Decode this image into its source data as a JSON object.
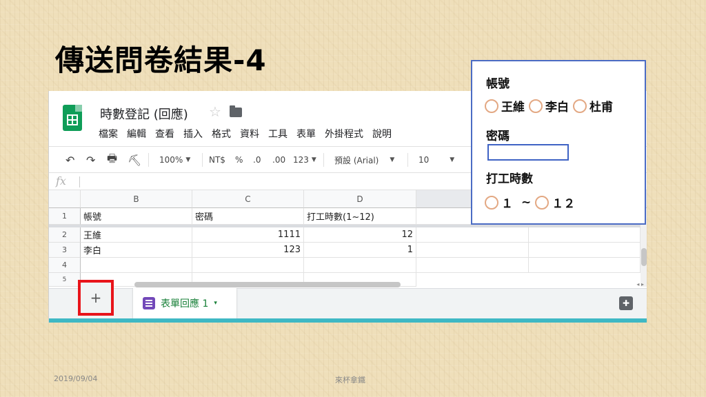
{
  "slide": {
    "title": "傳送問卷結果-4",
    "footer_date": "2019/09/04",
    "footer_center": "來杯拿鐵"
  },
  "app": {
    "doc_title": "時數登記 (回應)",
    "star_icon": "☆",
    "menu": [
      "檔案",
      "編輯",
      "查看",
      "插入",
      "格式",
      "資料",
      "工具",
      "表單",
      "外掛程式",
      "說明"
    ]
  },
  "toolbar": {
    "zoom": "100%",
    "currency": "NT$",
    "percent": "%",
    "dec_decrease": ".0",
    "dec_increase": ".00",
    "more_formats": "123",
    "font": "預設 (Arial)",
    "font_size": "10",
    "undo_icon": "↶",
    "redo_icon": "↷",
    "print_icon": "🖶",
    "paint_icon": "⛏"
  },
  "formula_bar": {
    "fx": "fx"
  },
  "sheet": {
    "columns": [
      "B",
      "C",
      "D",
      ""
    ],
    "rows": [
      {
        "num": "1",
        "cells": [
          "帳號",
          "密碼",
          "打工時數(1~12)",
          "",
          ""
        ]
      },
      {
        "num": "2",
        "cells": [
          "王維",
          "1111",
          "12",
          "",
          ""
        ]
      },
      {
        "num": "3",
        "cells": [
          "李白",
          "123",
          "1",
          "",
          ""
        ]
      },
      {
        "num": "4",
        "cells": [
          "",
          "",
          "",
          "",
          ""
        ]
      },
      {
        "num": "5",
        "cells": [
          "",
          "",
          "",
          "",
          ""
        ]
      }
    ]
  },
  "tabs": {
    "add_label": "+",
    "active_tab": "表單回應 1",
    "caret": "▾",
    "explore_icon": "✚"
  },
  "form": {
    "account_label": "帳號",
    "account_options": [
      "王維",
      "李白",
      "杜甫"
    ],
    "password_label": "密碼",
    "hours_label": "打工時數",
    "hours_min": "１",
    "hours_sep": "~",
    "hours_max": "１２"
  }
}
